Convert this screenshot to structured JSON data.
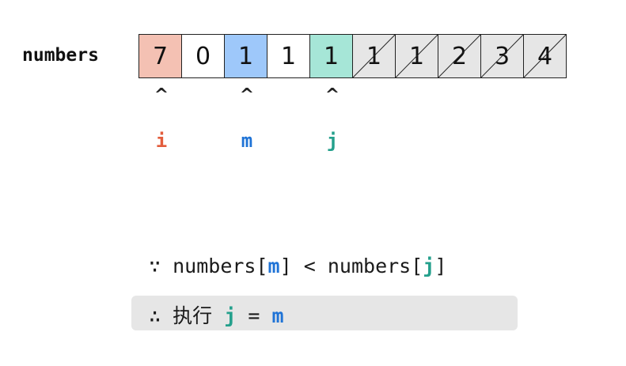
{
  "array": {
    "label": "numbers",
    "cells": [
      {
        "value": "7",
        "state": "hl-i"
      },
      {
        "value": "0",
        "state": "normal"
      },
      {
        "value": "1",
        "state": "hl-m"
      },
      {
        "value": "1",
        "state": "normal"
      },
      {
        "value": "1",
        "state": "hl-j"
      },
      {
        "value": "1",
        "state": "excluded"
      },
      {
        "value": "1",
        "state": "excluded"
      },
      {
        "value": "2",
        "state": "excluded"
      },
      {
        "value": "3",
        "state": "excluded"
      },
      {
        "value": "4",
        "state": "excluded"
      }
    ]
  },
  "pointers": [
    {
      "name": "i",
      "index": 0,
      "caret": "^",
      "color": "#e35d3c"
    },
    {
      "name": "m",
      "index": 2,
      "caret": "^",
      "color": "#1f73d6"
    },
    {
      "name": "j",
      "index": 4,
      "caret": "^",
      "color": "#24a08c"
    }
  ],
  "colors": {
    "i_fill": "#f4c1b3",
    "m_fill": "#9ec8fa",
    "j_fill": "#a6e6d7",
    "excluded_fill": "#e6e6e6"
  },
  "condition": {
    "because": "∵",
    "left_array": "numbers",
    "left_open": "[",
    "left_index": "m",
    "left_close": "]",
    "operator": "<",
    "right_array": "numbers",
    "right_open": "[",
    "right_index": "j",
    "right_close": "]"
  },
  "result": {
    "therefore": "∴",
    "action": "执行",
    "target": "j",
    "equals": "=",
    "source": "m"
  }
}
